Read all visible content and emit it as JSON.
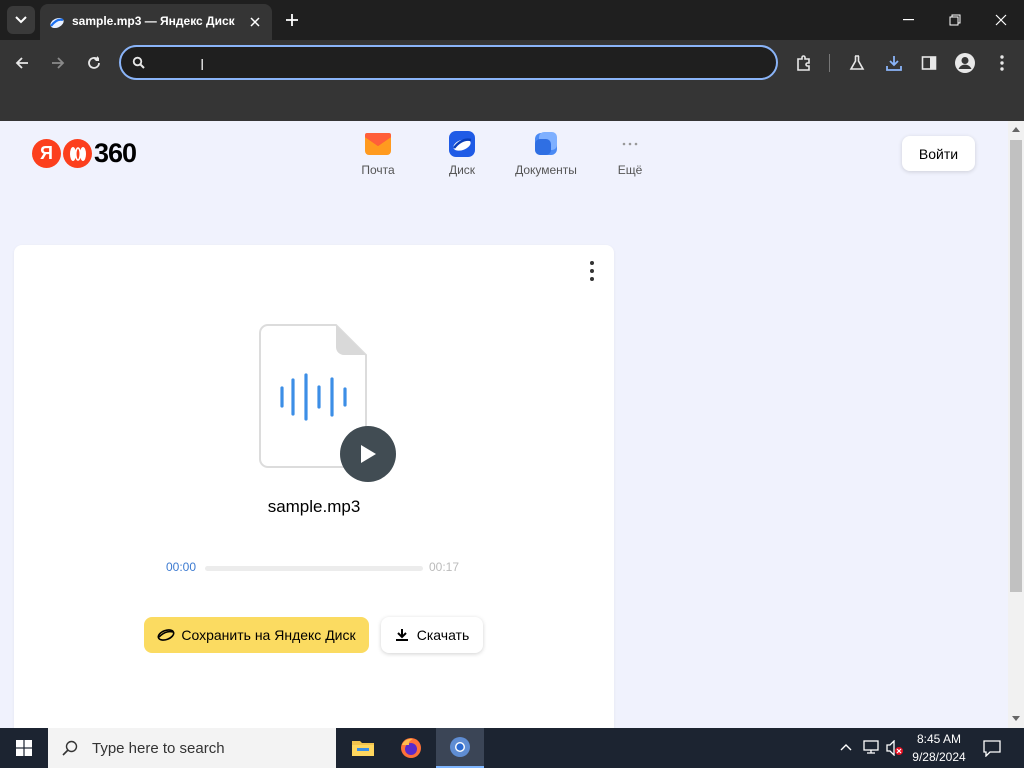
{
  "browser": {
    "tab_title": "sample.mp3 — Яндекс Диск",
    "omnibox": {
      "value": "",
      "placeholder": ""
    }
  },
  "header": {
    "logo_ya": "Я",
    "logo_360": "360",
    "services": [
      {
        "label": "Почта",
        "icon": "mail-icon"
      },
      {
        "label": "Диск",
        "icon": "disk-icon"
      },
      {
        "label": "Документы",
        "icon": "documents-icon"
      },
      {
        "label": "Ещё",
        "icon": "more-dots-icon"
      }
    ],
    "login_label": "Войти"
  },
  "player": {
    "file_name": "sample.mp3",
    "current_time": "00:00",
    "total_time": "00:17",
    "progress": 0,
    "save_label": "Сохранить на Яндекс Диск",
    "download_label": "Скачать"
  },
  "taskbar": {
    "search_placeholder": "Type here to search",
    "time": "8:45 AM",
    "date": "9/28/2024"
  },
  "colors": {
    "accent_yellow": "#fbdb61",
    "yandex_red": "#fc3f1d",
    "page_bg": "#f0f2fd",
    "omnibox_focus": "#8ab4f8"
  }
}
